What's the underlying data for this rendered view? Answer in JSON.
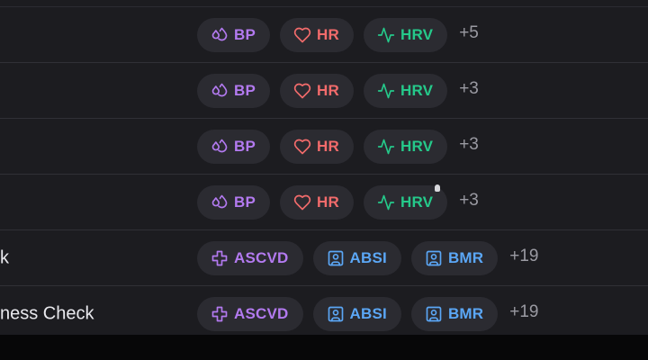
{
  "colors": {
    "purple": "#b37af0",
    "red": "#f26b6b",
    "green": "#25c98a",
    "blue": "#5ba7f6"
  },
  "rows": [
    {
      "title": "",
      "tags": [
        {
          "label": "BP",
          "icon": "drops-icon",
          "color": "#b37af0"
        },
        {
          "label": "HR",
          "icon": "heart-icon",
          "color": "#f26b6b"
        },
        {
          "label": "HRV",
          "icon": "pulse-icon",
          "color": "#25c98a"
        }
      ],
      "more": "+5"
    },
    {
      "title": "",
      "tags": [
        {
          "label": "BP",
          "icon": "drops-icon",
          "color": "#b37af0"
        },
        {
          "label": "HR",
          "icon": "heart-icon",
          "color": "#f26b6b"
        },
        {
          "label": "HRV",
          "icon": "pulse-icon",
          "color": "#25c98a"
        }
      ],
      "more": "+3"
    },
    {
      "title": "",
      "tags": [
        {
          "label": "BP",
          "icon": "drops-icon",
          "color": "#b37af0"
        },
        {
          "label": "HR",
          "icon": "heart-icon",
          "color": "#f26b6b"
        },
        {
          "label": "HRV",
          "icon": "pulse-icon",
          "color": "#25c98a"
        }
      ],
      "more": "+3"
    },
    {
      "title": "",
      "tags": [
        {
          "label": "BP",
          "icon": "drops-icon",
          "color": "#b37af0"
        },
        {
          "label": "HR",
          "icon": "heart-icon",
          "color": "#f26b6b"
        },
        {
          "label": "HRV",
          "icon": "pulse-icon",
          "color": "#25c98a"
        }
      ],
      "more": "+3"
    },
    {
      "title": "k",
      "tags": [
        {
          "label": "ASCVD",
          "icon": "plus-icon",
          "color": "#b37af0"
        },
        {
          "label": "ABSI",
          "icon": "person-icon",
          "color": "#5ba7f6"
        },
        {
          "label": "BMR",
          "icon": "person-icon",
          "color": "#5ba7f6"
        }
      ],
      "more": "+19"
    },
    {
      "title": "ness Check",
      "tags": [
        {
          "label": "ASCVD",
          "icon": "plus-icon",
          "color": "#b37af0"
        },
        {
          "label": "ABSI",
          "icon": "person-icon",
          "color": "#5ba7f6"
        },
        {
          "label": "BMR",
          "icon": "person-icon",
          "color": "#5ba7f6"
        }
      ],
      "more": "+19"
    }
  ]
}
